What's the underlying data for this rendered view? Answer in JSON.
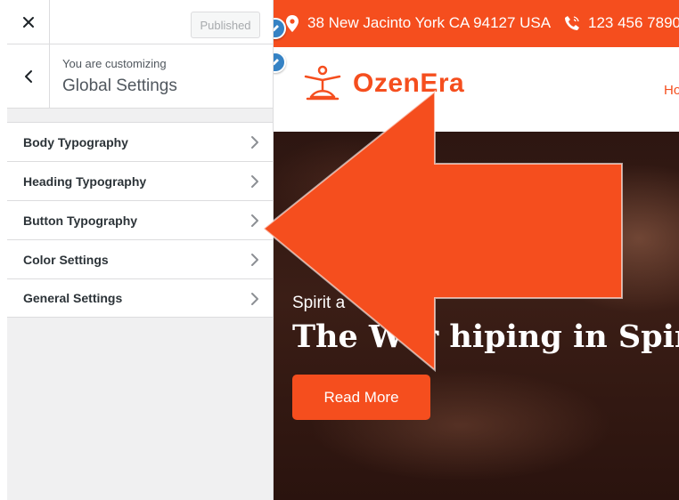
{
  "customizer": {
    "header": {
      "close_icon": "close-icon",
      "publish_label": "Published"
    },
    "section": {
      "back_icon": "chevron-left-icon",
      "customizing_label": "You are customizing",
      "title": "Global Settings"
    },
    "menu_items": [
      {
        "label": "Body Typography"
      },
      {
        "label": "Heading Typography"
      },
      {
        "label": "Button Typography"
      },
      {
        "label": "Color Settings"
      },
      {
        "label": "General Settings"
      }
    ]
  },
  "preview": {
    "topbar": {
      "address": "38 New Jacinto York CA 94127 USA",
      "phone": "123 456 7890"
    },
    "logo": {
      "text": "OzenEra"
    },
    "nav": {
      "first_item": "Ho"
    },
    "hero": {
      "subtitle": "Spirit a",
      "title": "The Wor  hiping in Spirit a",
      "button_label": "Read More"
    }
  },
  "colors": {
    "accent": "#f54e1e",
    "shortcut_blue": "#3582c4",
    "sidebar_bg": "#f0f0f1"
  }
}
